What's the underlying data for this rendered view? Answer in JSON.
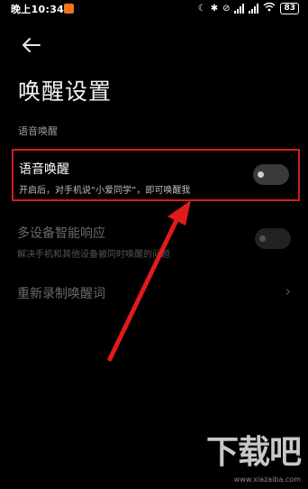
{
  "status_bar": {
    "time": "晚上10:34",
    "app_badge_color": "#f2711c",
    "icons": [
      "moon-icon",
      "bluetooth-icon",
      "silent-icon",
      "signal-icon",
      "signal-icon",
      "wifi-icon"
    ],
    "battery": "83"
  },
  "header": {
    "back_icon": "arrow-left-icon",
    "title": "唤醒设置"
  },
  "section": {
    "label": "语音唤醒"
  },
  "settings": [
    {
      "title": "语音唤醒",
      "desc": "开启后，对手机说“小爱同学”，即可唤醒我",
      "toggle_on": false,
      "highlighted": true
    },
    {
      "title": "多设备智能响应",
      "desc": "解决手机和其他设备被同时唤醒的问题",
      "toggle_on": false,
      "disabled": true
    },
    {
      "title": "重新录制唤醒词",
      "chevron": "chevron-right-icon",
      "disabled": true
    }
  ],
  "annotation": {
    "highlight_color": "#d41d1d",
    "arrow_color": "#e01b1b"
  },
  "watermark": {
    "logo_text": "下载吧",
    "url": "www.xiazaiba.com"
  }
}
